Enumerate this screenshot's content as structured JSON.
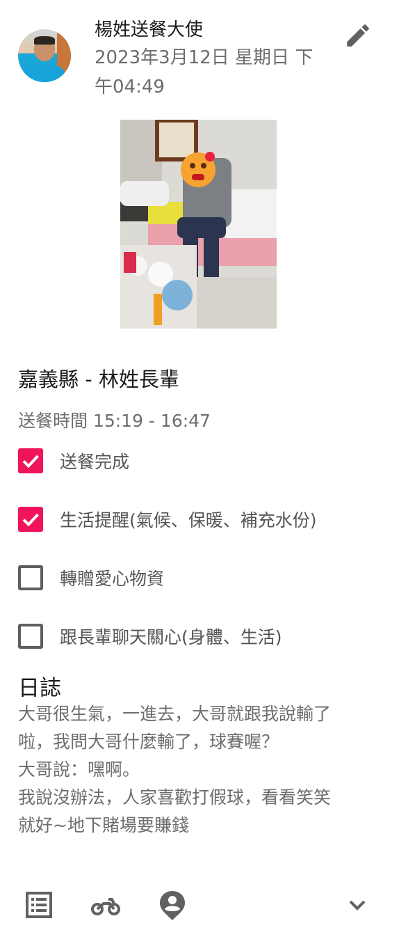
{
  "author": {
    "name": "楊姓送餐大使",
    "posted_at": "2023年3月12日 星期日 下午04:49"
  },
  "place": "嘉義縣 - 林姓長輩",
  "delivery_time": "送餐時間 15:19 - 16:47",
  "checklist": [
    {
      "label": "送餐完成",
      "checked": true
    },
    {
      "label": "生活提醒(氣候、保暖、補充水份)",
      "checked": true
    },
    {
      "label": "轉贈愛心物資",
      "checked": false
    },
    {
      "label": "跟長輩聊天關心(身體、生活)",
      "checked": false
    }
  ],
  "log": {
    "title": "日誌",
    "lines": [
      "大哥很生氣，一進去，大哥就跟我說輸了",
      "啦，我問大哥什麼輸了，球賽喔？",
      "大哥說：嘿啊。",
      "我說沒辦法，人家喜歡打假球，看看笑笑",
      "就好~地下賭場要賺錢"
    ]
  },
  "icons": {
    "edit": "pencil-icon",
    "bottom": [
      "list-icon",
      "motorcycle-icon",
      "person-pin-icon",
      "chevron-down-icon"
    ]
  },
  "colors": {
    "accent": "#f0145a",
    "text_secondary": "#6d6d6d",
    "icon": "#616161"
  }
}
